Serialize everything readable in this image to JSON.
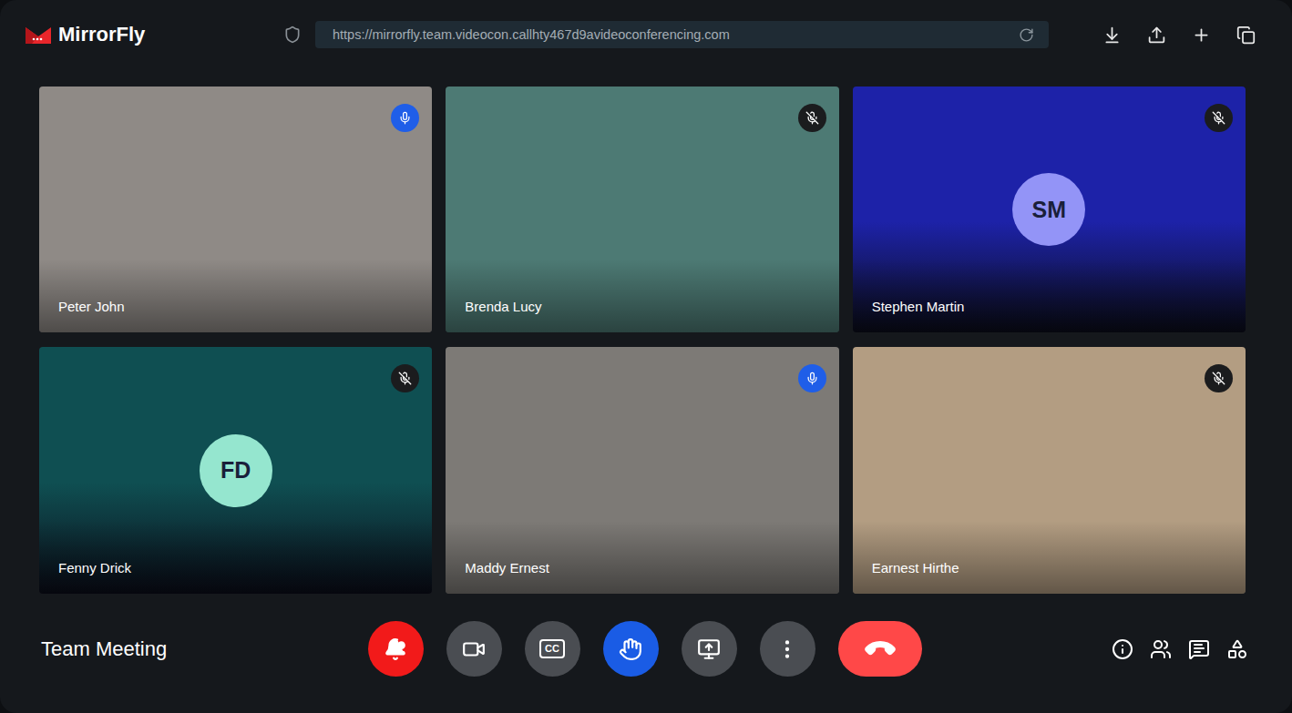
{
  "app": {
    "logo": "MirrorFly",
    "url": "https://mirrorfly.team.videocon.callhty467d9avideoconferencing.com"
  },
  "participants": [
    {
      "name": "Peter John",
      "kind": "video",
      "mic_on": true,
      "color": "#8f8a86"
    },
    {
      "name": "Brenda Lucy",
      "kind": "video",
      "mic_on": false,
      "color": "#4d7a74"
    },
    {
      "name": "Stephen Martin",
      "kind": "avatar",
      "initials": "SM",
      "mic_on": false,
      "color": "#1d22a8",
      "avatar_color": "#9394f7"
    },
    {
      "name": "Fenny Drick",
      "kind": "avatar",
      "initials": "FD",
      "mic_on": false,
      "color": "#0f4f52",
      "avatar_color": "#95e6cf"
    },
    {
      "name": "Maddy Ernest",
      "kind": "video",
      "mic_on": true,
      "color": "#7d7a76"
    },
    {
      "name": "Earnest Hirthe",
      "kind": "video",
      "mic_on": false,
      "color": "#b39d82"
    }
  ],
  "meeting": {
    "title": "Team Meeting"
  },
  "controls": [
    {
      "kind": "alert",
      "color": "#f21a1a"
    },
    {
      "kind": "camera",
      "color": "#4a4d52"
    },
    {
      "kind": "captions",
      "label": "CC",
      "color": "#4a4d52"
    },
    {
      "kind": "hand",
      "color": "#1a5ce5"
    },
    {
      "kind": "share",
      "color": "#4a4d52"
    },
    {
      "kind": "more",
      "color": "#4a4d52"
    },
    {
      "kind": "end",
      "color": "#ff4848"
    }
  ]
}
